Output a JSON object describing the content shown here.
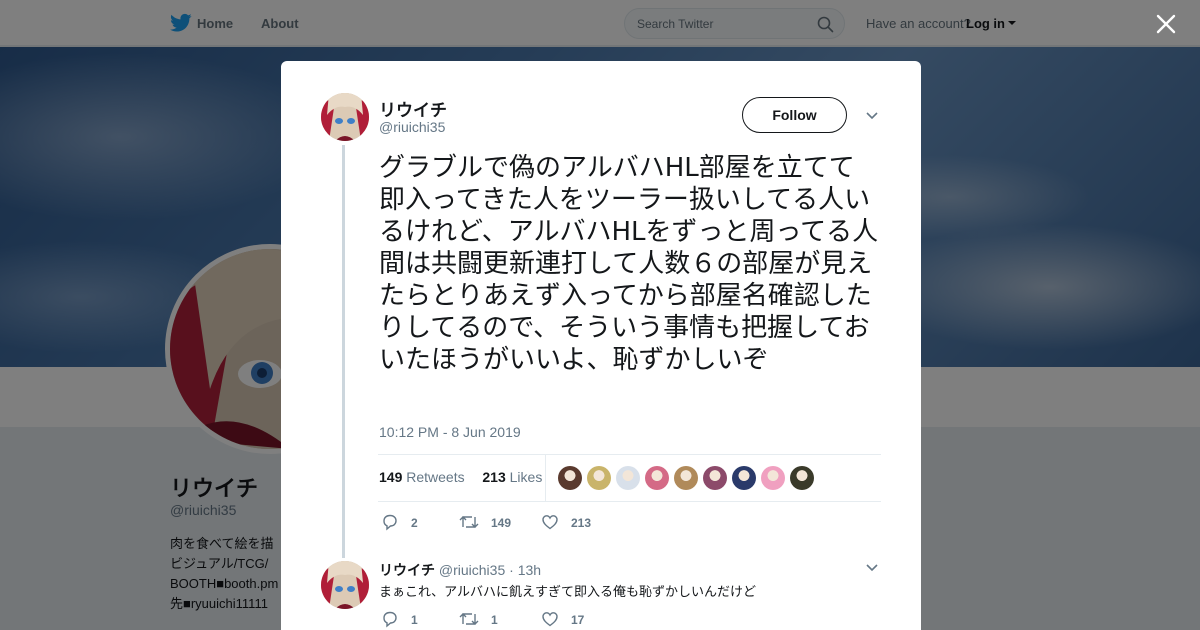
{
  "topbar": {
    "home_label": "Home",
    "about_label": "About",
    "search_placeholder": "Search Twitter",
    "have_account": "Have an account?",
    "login_label": "Log in"
  },
  "profile": {
    "name": "リウイチ",
    "handle": "@riuichi35",
    "bio_lines": [
      "肉を食べて絵を描",
      "ビジュアル/TCG/",
      "BOOTH■booth.pm",
      "先■ryuuichi11111"
    ]
  },
  "tweet": {
    "author_name": "リウイチ",
    "author_handle": "@riuichi35",
    "follow_label": "Follow",
    "text": "グラブルで偽のアルバハHL部屋を立てて即入ってきた人をツーラー扱いしてる人いるけれど、アルバハHLをずっと周ってる人間は共闘更新連打して人数６の部屋が見えたらとりあえず入ってから部屋名確認したりしてるので、そういう事情も把握しておいたほうがいいよ、恥ずかしいぞ",
    "timestamp": "10:12 PM - 8 Jun 2019",
    "retweets_count": "149",
    "retweets_label": "Retweets",
    "likes_count": "213",
    "likes_label": "Likes",
    "actions": {
      "replies": "2",
      "retweets": "149",
      "likes": "213"
    }
  },
  "liker_avatar_colors": [
    "#5a3a2e",
    "#c9b46a",
    "#d8e0ea",
    "#d46a86",
    "#b08a5a",
    "#8c4a6a",
    "#2a3a6a",
    "#f0a0c0",
    "#3a3a2a"
  ],
  "reply": {
    "author_name": "リウイチ",
    "author_handle": "@riuichi35",
    "time": "· 13h",
    "text": "まぁこれ、アルバハに飢えすぎて即入る俺も恥ずかしいんだけど",
    "actions": {
      "replies": "1",
      "retweets": "1",
      "likes": "17"
    }
  },
  "colors": {
    "twitter_blue": "#1da1f2",
    "muted": "#657786",
    "modal_bg": "#ffffff"
  }
}
